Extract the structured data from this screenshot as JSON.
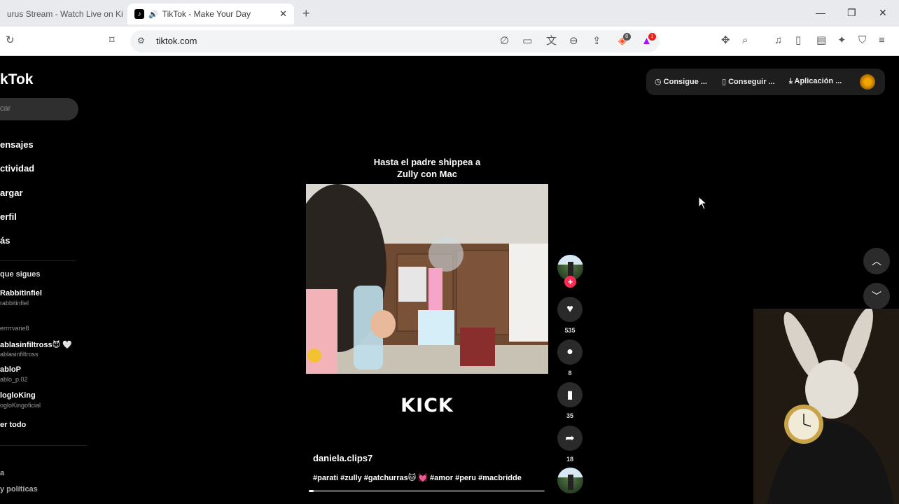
{
  "browser": {
    "tabs": [
      {
        "title": "urus Stream - Watch Live on Kick",
        "active": false
      },
      {
        "title": "TikTok - Make Your Day",
        "active": true
      }
    ],
    "url": "tiktok.com",
    "extension_badges": {
      "brave": "8",
      "rewards": "1"
    }
  },
  "sidebar": {
    "logo": "kTok",
    "search_placeholder": "car",
    "nav": [
      "ensajes",
      "ctividad",
      "argar",
      "erfil",
      "ás"
    ],
    "following_title": "que sigues",
    "accounts": [
      {
        "name": "RabbitInfiel",
        "handle": "rabbitinfiel"
      },
      {
        "name": "",
        "handle": "errrrvane8"
      },
      {
        "name": "ablasinfiltross😈 🤍",
        "handle": "ablasinfiltross"
      },
      {
        "name": "abloP",
        "handle": "ablo_p.02"
      },
      {
        "name": "logloKing",
        "handle": "ogloKingoficial"
      }
    ],
    "see_all": "er todo",
    "footer": [
      "a",
      "y políticas"
    ]
  },
  "top_actions": [
    "Consigue ...",
    "Conseguir ...",
    "Aplicación ..."
  ],
  "video": {
    "caption_line1": "Hasta el padre shippea a",
    "caption_line2": "Zully con Mac",
    "watermark": "KICK",
    "author": "daniela.clips7",
    "hashtags": "#parati #zully #gatchurras🐱 💓  #amor #peru #macbridde",
    "progress": 0.02,
    "likes": "535",
    "comments": "8",
    "saves": "35",
    "shares": "18"
  },
  "colors": {
    "accent": "#fe2c55",
    "background": "#000000"
  }
}
